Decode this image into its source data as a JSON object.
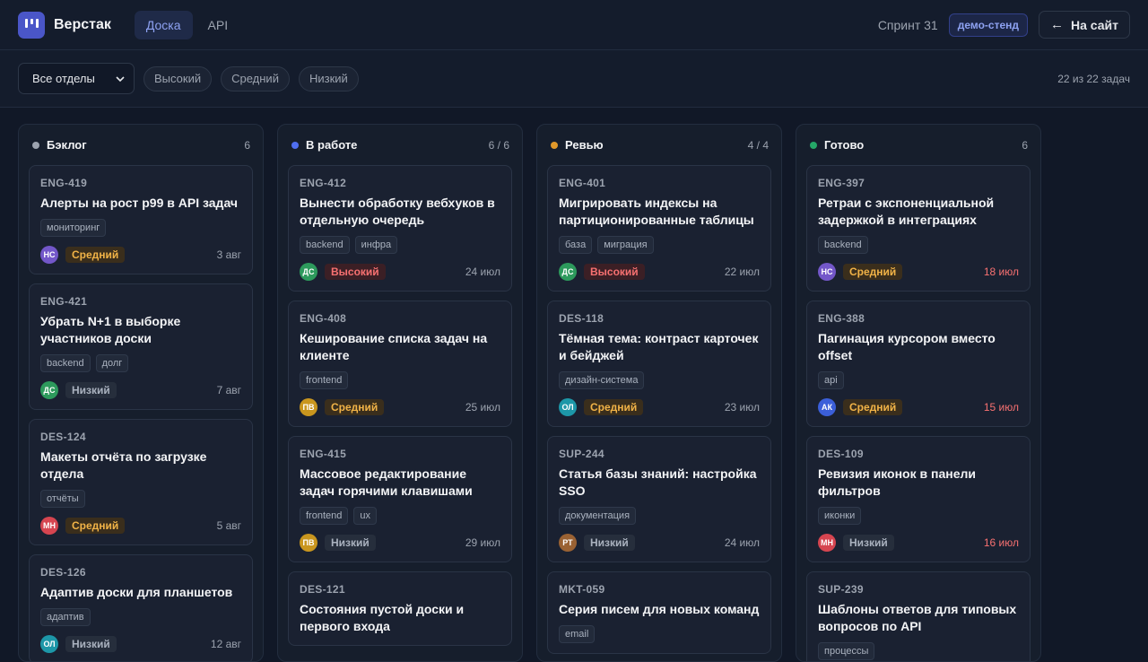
{
  "app": {
    "name": "Верстак"
  },
  "nav": {
    "tabs": [
      {
        "label": "Доска",
        "active": true
      },
      {
        "label": "API",
        "active": false
      }
    ]
  },
  "header": {
    "sprint": "Спринт 31",
    "env_badge": "демо-стенд",
    "exit_label": "На сайт",
    "exit_icon": "arrow-left-icon"
  },
  "filters": {
    "department": "Все отделы",
    "priority_chips": [
      "Высокий",
      "Средний",
      "Низкий"
    ],
    "count_text": "22 из 22 задач"
  },
  "colors": {
    "accent": "#4a56c8",
    "high": "#f87171",
    "medium": "#f1b347",
    "low": "#aab2bf"
  },
  "columns": [
    {
      "name": "Бэклог",
      "count": "6",
      "dot": "#9ca3af",
      "cards": [
        {
          "id": "ENG-419",
          "title": "Алерты на рост p99 в API задач",
          "tags": [
            "мониторинг"
          ],
          "avatar": "НС",
          "avatar_color": "#7357c9",
          "priority": "Средний",
          "due": "3 авг",
          "overdue": false
        },
        {
          "id": "ENG-421",
          "title": "Убрать N+1 в выборке участников доски",
          "tags": [
            "backend",
            "долг"
          ],
          "avatar": "ДС",
          "avatar_color": "#2d9a5c",
          "priority": "Низкий",
          "due": "7 авг",
          "overdue": false
        },
        {
          "id": "DES-124",
          "title": "Макеты отчёта по загрузке отдела",
          "tags": [
            "отчёты"
          ],
          "avatar": "МН",
          "avatar_color": "#d64550",
          "priority": "Средний",
          "due": "5 авг",
          "overdue": false
        },
        {
          "id": "DES-126",
          "title": "Адаптив доски для планшетов",
          "tags": [
            "адаптив"
          ],
          "avatar": "ОЛ",
          "avatar_color": "#1d97a8",
          "priority": "Низкий",
          "due": "12 авг",
          "overdue": false
        }
      ]
    },
    {
      "name": "В работе",
      "count": "6 / 6",
      "dot": "#4f6ef0",
      "cards": [
        {
          "id": "ENG-412",
          "title": "Вынести обработку вебхуков в отдельную очередь",
          "tags": [
            "backend",
            "инфра"
          ],
          "avatar": "ДС",
          "avatar_color": "#2d9a5c",
          "priority": "Высокий",
          "due": "24 июл",
          "overdue": false
        },
        {
          "id": "ENG-408",
          "title": "Кеширование списка задач на клиенте",
          "tags": [
            "frontend"
          ],
          "avatar": "ПВ",
          "avatar_color": "#c9961e",
          "priority": "Средний",
          "due": "25 июл",
          "overdue": false
        },
        {
          "id": "ENG-415",
          "title": "Массовое редактирование задач горячими клавишами",
          "tags": [
            "frontend",
            "ux"
          ],
          "avatar": "ПВ",
          "avatar_color": "#c9961e",
          "priority": "Низкий",
          "due": "29 июл",
          "overdue": false
        },
        {
          "id": "DES-121",
          "title": "Состояния пустой доски и первого входа",
          "tags": [],
          "avatar": "",
          "avatar_color": "#4b5563",
          "priority": "",
          "due": "",
          "overdue": false
        }
      ]
    },
    {
      "name": "Ревью",
      "count": "4 / 4",
      "dot": "#e0982a",
      "cards": [
        {
          "id": "ENG-401",
          "title": "Мигрировать индексы на партиционированные таблицы",
          "tags": [
            "база",
            "миграция"
          ],
          "avatar": "ДС",
          "avatar_color": "#2d9a5c",
          "priority": "Высокий",
          "due": "22 июл",
          "overdue": false
        },
        {
          "id": "DES-118",
          "title": "Тёмная тема: контраст карточек и бейджей",
          "tags": [
            "дизайн-система"
          ],
          "avatar": "ОЛ",
          "avatar_color": "#1d97a8",
          "priority": "Средний",
          "due": "23 июл",
          "overdue": false
        },
        {
          "id": "SUP-244",
          "title": "Статья базы знаний: настройка SSO",
          "tags": [
            "документация"
          ],
          "avatar": "РТ",
          "avatar_color": "#9a6233",
          "priority": "Низкий",
          "due": "24 июл",
          "overdue": false
        },
        {
          "id": "MKT-059",
          "title": "Серия писем для новых команд",
          "tags": [
            "email"
          ],
          "avatar": "",
          "avatar_color": "#4b5563",
          "priority": "",
          "due": "",
          "overdue": false
        }
      ]
    },
    {
      "name": "Готово",
      "count": "6",
      "dot": "#25a768",
      "cards": [
        {
          "id": "ENG-397",
          "title": "Ретраи с экспоненциальной задержкой в интеграциях",
          "tags": [
            "backend"
          ],
          "avatar": "НС",
          "avatar_color": "#7357c9",
          "priority": "Средний",
          "due": "18 июл",
          "overdue": true
        },
        {
          "id": "ENG-388",
          "title": "Пагинация курсором вместо offset",
          "tags": [
            "api"
          ],
          "avatar": "АК",
          "avatar_color": "#3b5fd9",
          "priority": "Средний",
          "due": "15 июл",
          "overdue": true
        },
        {
          "id": "DES-109",
          "title": "Ревизия иконок в панели фильтров",
          "tags": [
            "иконки"
          ],
          "avatar": "МН",
          "avatar_color": "#d64550",
          "priority": "Низкий",
          "due": "16 июл",
          "overdue": true
        },
        {
          "id": "SUP-239",
          "title": "Шаблоны ответов для типовых вопросов по API",
          "tags": [
            "процессы"
          ],
          "avatar": "",
          "avatar_color": "#4b5563",
          "priority": "",
          "due": "",
          "overdue": false
        }
      ]
    }
  ]
}
